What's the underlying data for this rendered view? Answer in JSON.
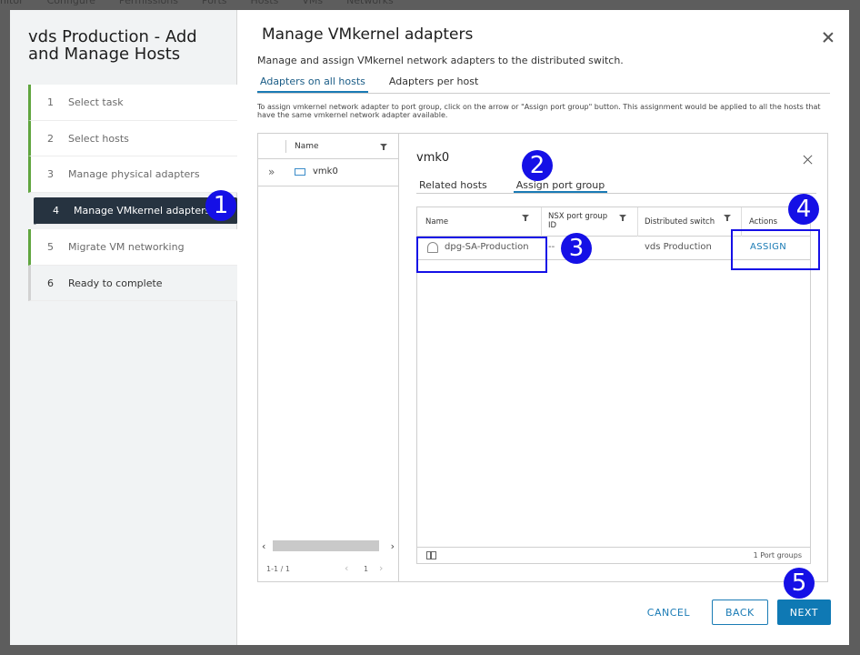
{
  "background": {
    "tabs": [
      "nitor",
      "Configure",
      "Permissions",
      "Ports",
      "Hosts",
      "VMs",
      "Networks"
    ]
  },
  "wizard": {
    "title": "vds Production - Add and Manage Hosts",
    "steps": [
      {
        "num": "1",
        "label": "Select task"
      },
      {
        "num": "2",
        "label": "Select hosts"
      },
      {
        "num": "3",
        "label": "Manage physical adapters"
      },
      {
        "num": "4",
        "label": "Manage VMkernel adapters"
      },
      {
        "num": "5",
        "label": "Migrate VM networking"
      },
      {
        "num": "6",
        "label": "Ready to complete"
      }
    ]
  },
  "page": {
    "title": "Manage VMkernel adapters",
    "description": "Manage and assign VMkernel network adapters to the distributed switch.",
    "tabs": [
      "Adapters on all hosts",
      "Adapters per host"
    ],
    "note": "To assign vmkernel network adapter to port group, click on the arrow or \"Assign port group\" button. This assignment would be applied to all the hosts that have the same vmkernel network adapter available."
  },
  "adapter_grid": {
    "column": "Name",
    "rows": [
      "vmk0"
    ],
    "pager_count": "1-1 / 1",
    "page": "1"
  },
  "detail": {
    "title": "vmk0",
    "tabs": [
      "Related hosts",
      "Assign port group"
    ],
    "columns": [
      "Name",
      "NSX port group ID",
      "Distributed switch",
      "Actions"
    ],
    "row": {
      "name": "dpg-SA-Production",
      "nsx_id": "--",
      "switch": "vds Production",
      "action": "ASSIGN"
    },
    "footer_count": "1 Port groups"
  },
  "buttons": {
    "cancel": "CANCEL",
    "back": "BACK",
    "next": "NEXT"
  },
  "annotations": [
    "1",
    "2",
    "3",
    "4",
    "5"
  ]
}
